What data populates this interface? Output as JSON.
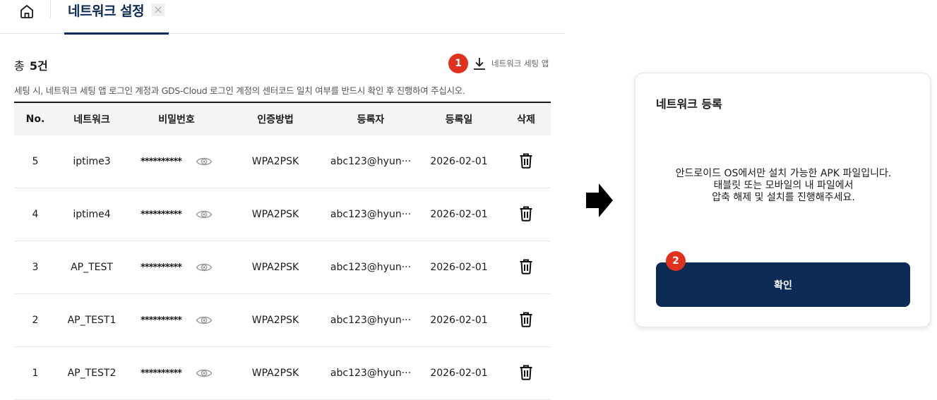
{
  "tab": {
    "label": "네트워크 설정"
  },
  "list": {
    "total_prefix": "총",
    "total_count": "5건",
    "download_badge": "1",
    "download_label": "네트워크 세팅 앱",
    "notice": "세팅 시, 네트워크 세팅 앱 로그인 계정과 GDS-Cloud 로그인 계정의 센터코드 일치 여부를 반드시 확인 후 진행하여 주십시오."
  },
  "table": {
    "headers": [
      "No.",
      "네트워크",
      "비밀번호",
      "인증방법",
      "등록자",
      "등록일",
      "삭제"
    ],
    "rows": [
      {
        "no": "5",
        "network": "iptime3",
        "password": "**********",
        "auth": "WPA2PSK",
        "registrant": "abc123@hyun···",
        "date": "2026-02-01"
      },
      {
        "no": "4",
        "network": "iptime4",
        "password": "**********",
        "auth": "WPA2PSK",
        "registrant": "abc123@hyun···",
        "date": "2026-02-01"
      },
      {
        "no": "3",
        "network": "AP_TEST",
        "password": "**********",
        "auth": "WPA2PSK",
        "registrant": "abc123@hyun···",
        "date": "2026-02-01"
      },
      {
        "no": "2",
        "network": "AP_TEST1",
        "password": "**********",
        "auth": "WPA2PSK",
        "registrant": "abc123@hyun···",
        "date": "2026-02-01"
      },
      {
        "no": "1",
        "network": "AP_TEST2",
        "password": "**********",
        "auth": "WPA2PSK",
        "registrant": "abc123@hyun···",
        "date": "2026-02-01"
      }
    ]
  },
  "modal": {
    "title": "네트워크 등록",
    "message": [
      "안드로이드 OS에서만 설치 가능한 APK 파일입니다.",
      "태블릿 또는 모바일의 내 파일에서",
      "압축 해제 및 설치를 진행해주세요."
    ],
    "confirm_label": "확인",
    "confirm_badge": "2"
  },
  "icons": {
    "home": "home-icon",
    "close": "close-icon",
    "download": "download-icon",
    "eye": "eye-icon",
    "trash": "trash-icon",
    "arrow": "arrow-right-icon"
  },
  "colors": {
    "brand": "#0b2a55",
    "badge": "#e0301e",
    "header_bg": "#f4f4f5"
  }
}
